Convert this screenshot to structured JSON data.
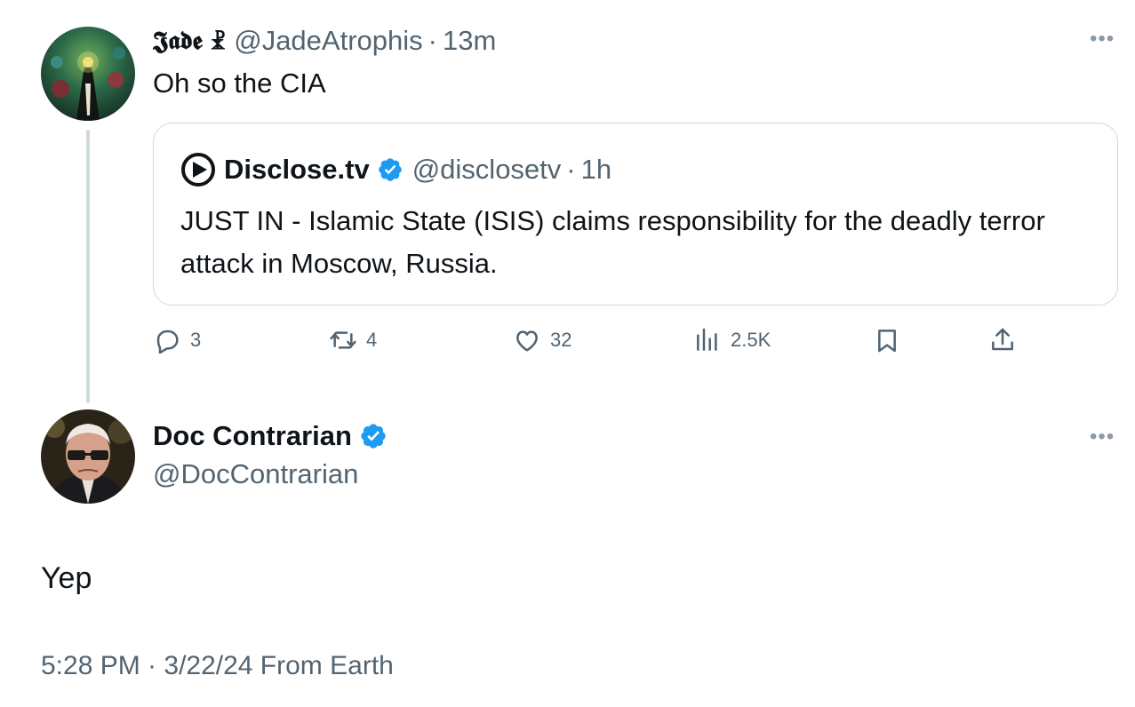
{
  "parent_tweet": {
    "author_name": "𝕵𝖆𝖉𝖊 ☧",
    "handle": "@JadeAtrophis",
    "separator": "·",
    "time": "13m",
    "text": "Oh so the CIA",
    "more_icon": "more-horizontal-icon",
    "quote": {
      "author_name": "Disclose.tv",
      "verified": true,
      "handle": "@disclosetv",
      "separator": "·",
      "time": "1h",
      "text": "JUST IN - Islamic State (ISIS) claims responsibility for the deadly terror attack in Moscow, Russia."
    },
    "actions": {
      "replies": "3",
      "reposts": "4",
      "likes": "32",
      "views": "2.5K"
    }
  },
  "reply_tweet": {
    "author_name": "Doc Contrarian",
    "verified": true,
    "handle": "@DocContrarian",
    "text": "Yep",
    "meta": "5:28 PM · 3/22/24 From Earth"
  },
  "colors": {
    "text": "#0f1419",
    "secondary": "#536471",
    "verified_blue": "#1d9bf0",
    "border": "#cfd9de"
  }
}
